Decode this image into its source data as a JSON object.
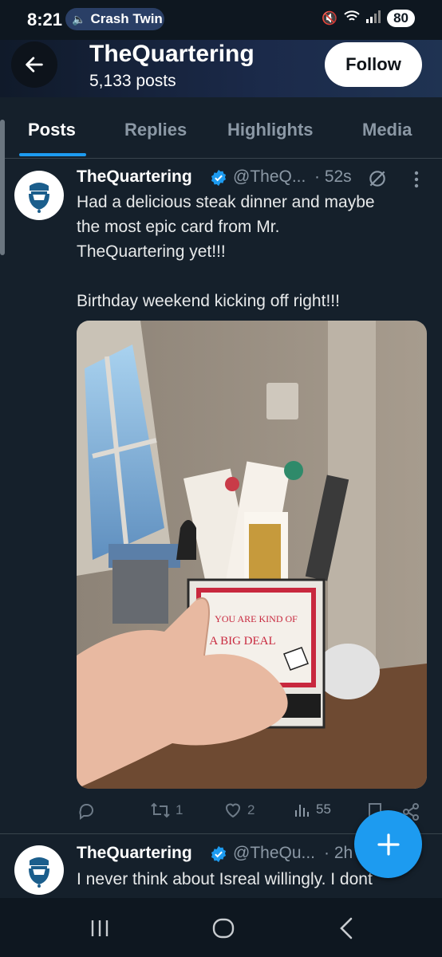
{
  "status_bar": {
    "time": "8:21",
    "media_label": "Crash Twin",
    "battery": "80"
  },
  "header": {
    "name": "TheQuartering",
    "post_count": "5,133 posts",
    "follow_label": "Follow"
  },
  "tabs": [
    {
      "label": "Posts",
      "active": true
    },
    {
      "label": "Replies",
      "active": false
    },
    {
      "label": "Highlights",
      "active": false
    },
    {
      "label": "Media",
      "active": false
    }
  ],
  "tweets": [
    {
      "name": "TheQuartering",
      "handle": "@TheQ...",
      "time": "· 52s",
      "text_lines": [
        "Had a delicious steak dinner and maybe",
        "the most epic card from Mr.",
        "TheQuartering yet!!!",
        "",
        "Birthday weekend kicking off right!!!"
      ],
      "image_card_lines": [
        "YOU ARE KIND OF",
        "A BIG DEAL"
      ],
      "stats": {
        "replies": "",
        "retweets": "1",
        "likes": "2",
        "views": "55"
      }
    },
    {
      "name": "TheQuartering",
      "handle": "@TheQu...",
      "time": "· 2h",
      "text_lines": [
        "I never think about Isreal willingly. I dont"
      ]
    }
  ],
  "colors": {
    "accent": "#1d9bf0",
    "background": "#15202b",
    "text": "#e7e9ea",
    "muted": "#8b98a5"
  },
  "icons": [
    "back-arrow-icon",
    "verified-badge-icon",
    "grok-icon",
    "more-icon",
    "reply-icon",
    "retweet-icon",
    "like-icon",
    "views-icon",
    "bookmark-icon",
    "share-icon",
    "compose-plus-icon",
    "recents-nav-icon",
    "home-nav-icon",
    "back-nav-icon"
  ]
}
